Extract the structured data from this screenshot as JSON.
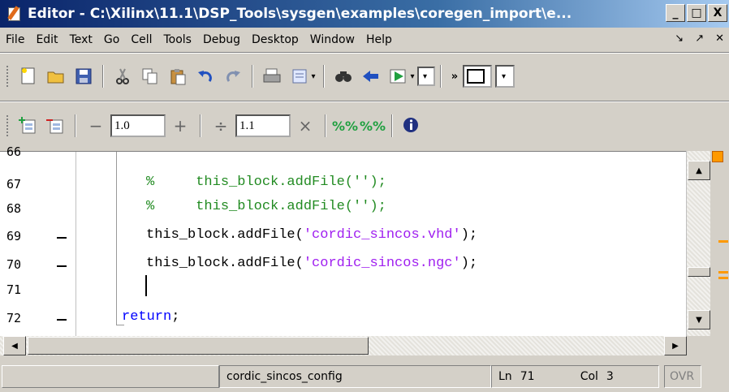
{
  "window": {
    "title": "Editor - C:\\Xilinx\\11.1\\DSP_Tools\\sysgen\\examples\\coregen_import\\e...",
    "min_glyph": "_",
    "max_glyph": "□",
    "close_glyph": "X"
  },
  "menu": {
    "items": [
      "File",
      "Edit",
      "Text",
      "Go",
      "Cell",
      "Tools",
      "Debug",
      "Desktop",
      "Window",
      "Help"
    ],
    "dock_glyph": "↘",
    "undock_glyph": "↗",
    "close_glyph": "✕"
  },
  "toolbar2": {
    "decrement_glyph": "−",
    "increment_glyph": "+",
    "divide_glyph": "÷",
    "multiply_glyph": "×",
    "value_a": "1.0",
    "value_b": "1.1"
  },
  "editor": {
    "lines": [
      {
        "num": "66"
      },
      {
        "num": "67"
      },
      {
        "num": "68"
      },
      {
        "num": "69"
      },
      {
        "num": "70"
      },
      {
        "num": "71"
      },
      {
        "num": "72"
      }
    ],
    "code": {
      "l67_pct": "%",
      "l67_text": "this_block.addFile('');",
      "l68_pct": "%",
      "l68_text": "this_block.addFile('');",
      "l69_pre": "this_block.addFile(",
      "l69_str": "'cordic_sincos.vhd'",
      "l69_post": ");",
      "l70_pre": "this_block.addFile(",
      "l70_str": "'cordic_sincos.ngc'",
      "l70_post": ");",
      "l72_kw": "return",
      "l72_post": ";"
    }
  },
  "status": {
    "function_name": "cordic_sincos_config",
    "ln_label": "Ln",
    "ln_value": "71",
    "col_label": "Col",
    "col_value": "3",
    "mode": "OVR"
  },
  "colors": {
    "comment": "#228b22",
    "string": "#a020f0",
    "keyword": "#0000ff",
    "marker": "#ff9900"
  }
}
